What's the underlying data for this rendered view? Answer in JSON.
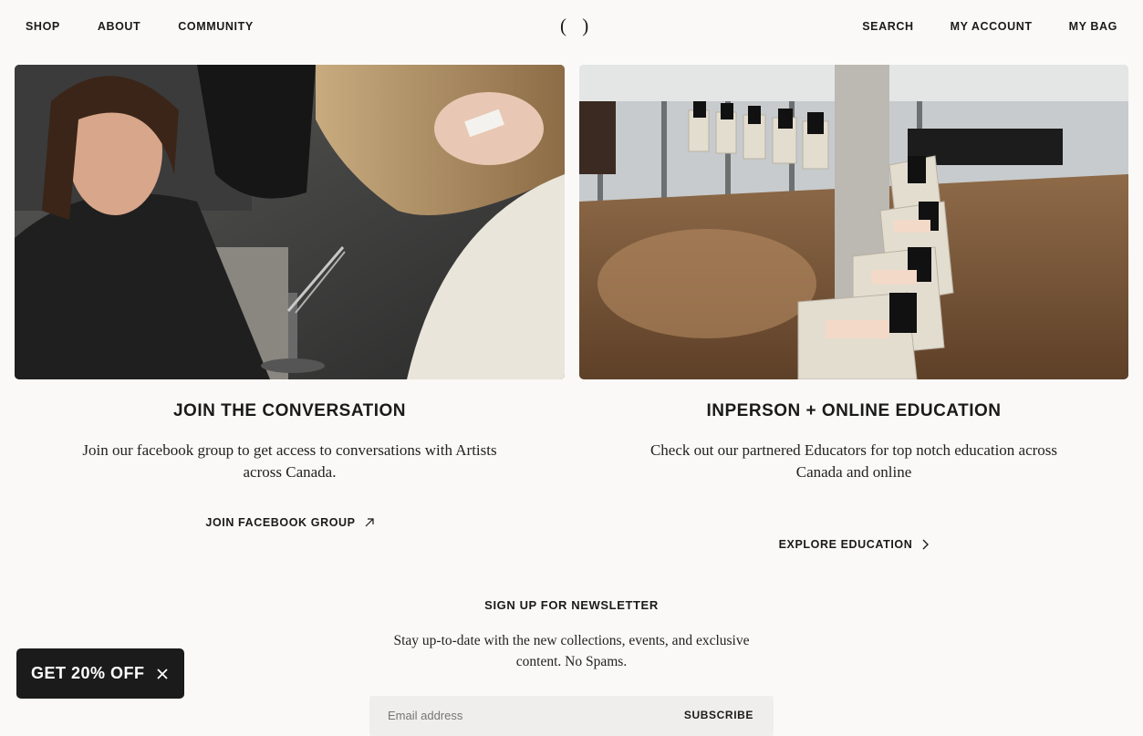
{
  "header": {
    "nav_left": [
      "SHOP",
      "ABOUT",
      "COMMUNITY"
    ],
    "logo": "( )",
    "nav_right": [
      "SEARCH",
      "MY ACCOUNT",
      "MY BAG"
    ]
  },
  "community": {
    "title": "JOIN THE CONVERSATION",
    "text": "Join our facebook group to get access to conversations with Artists across Canada.",
    "cta": "JOIN FACEBOOK GROUP"
  },
  "education": {
    "title": "INPERSON + ONLINE EDUCATION",
    "text": "Check out our partnered Educators for top notch education across Canada and online",
    "cta": "EXPLORE EDUCATION"
  },
  "newsletter": {
    "title": "SIGN UP FOR NEWSLETTER",
    "text": "Stay up-to-date with the new collections, events, and exclusive content. No Spams.",
    "email_placeholder": "Email address",
    "submit": "SUBSCRIBE"
  },
  "promo": {
    "label": "GET 20% OFF"
  },
  "colors": {
    "background": "#faf9f7",
    "text": "#1a1a1a",
    "promo_bg": "#1b1b1b"
  }
}
